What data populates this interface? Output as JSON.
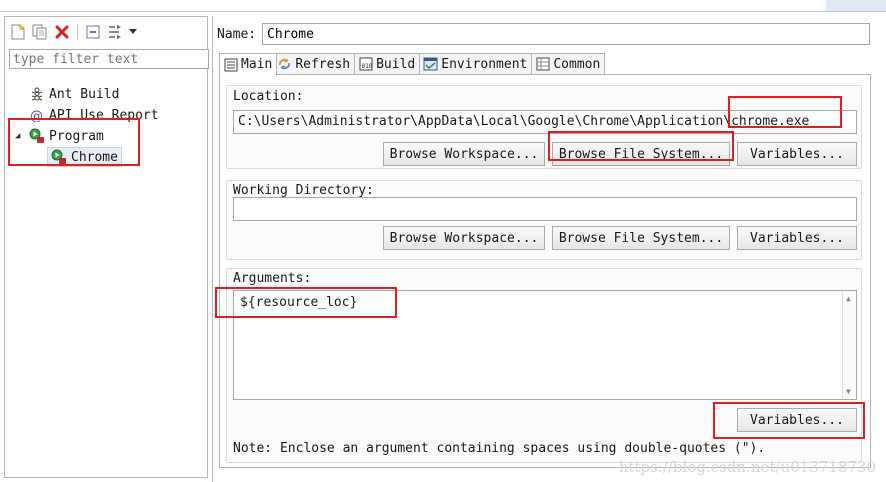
{
  "left_panel": {
    "toolbar": {
      "icons": [
        "new-configuration-icon",
        "duplicate-icon",
        "delete-icon",
        "collapse-all-icon",
        "filter-icon",
        "dropdown-arrow-icon"
      ]
    },
    "filter_placeholder": "type filter text",
    "tree": {
      "items": [
        {
          "label": "Ant Build",
          "icon": "ant-icon"
        },
        {
          "label": "API Use Report",
          "icon": "api-report-icon"
        },
        {
          "label": "Program",
          "icon": "program-icon",
          "expanded": true
        },
        {
          "label": "Chrome",
          "icon": "program-launch-icon",
          "selected": true
        }
      ]
    }
  },
  "right_panel": {
    "name_label": "Name:",
    "name_value": "Chrome",
    "tabs": [
      {
        "label": "Main",
        "icon": "main-tab-icon",
        "active": true
      },
      {
        "label": "Refresh",
        "icon": "refresh-icon"
      },
      {
        "label": "Build",
        "icon": "build-icon"
      },
      {
        "label": "Environment",
        "icon": "environment-icon"
      },
      {
        "label": "Common",
        "icon": "common-icon"
      }
    ],
    "location": {
      "label": "Location:",
      "value": "C:\\Users\\Administrator\\AppData\\Local\\Google\\Chrome\\Application\\chrome.exe",
      "buttons": [
        "Browse Workspace...",
        "Browse File System...",
        "Variables..."
      ]
    },
    "working_directory": {
      "label": "Working Directory:",
      "value": "",
      "buttons": [
        "Browse Workspace...",
        "Browse File System...",
        "Variables..."
      ]
    },
    "arguments": {
      "label": "Arguments:",
      "value": "${resource_loc}",
      "variables_button": "Variables..."
    },
    "note": "Note: Enclose an argument containing spaces using double-quotes (\")."
  },
  "watermark": "https://blog.csdn.net/u013718730",
  "colors": {
    "highlight_box": "#e02020",
    "selection_bg": "#e8eef7",
    "border": "#b5b5b5"
  }
}
